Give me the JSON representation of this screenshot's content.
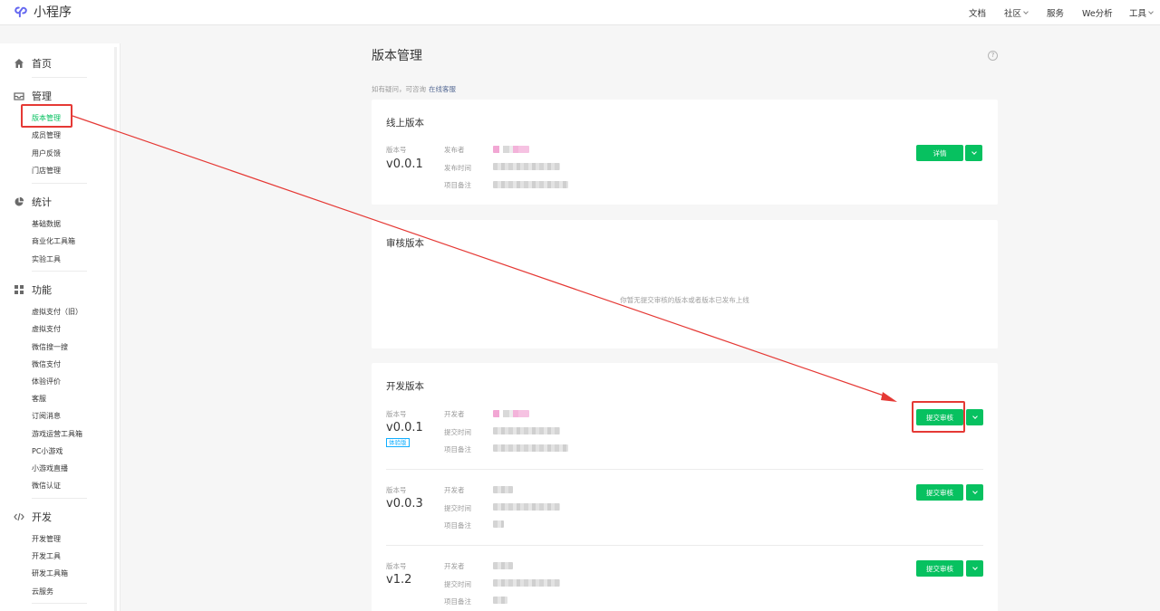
{
  "topbar": {
    "app_title": "小程序",
    "nav": [
      {
        "label": "文档",
        "dropdown": false
      },
      {
        "label": "社区",
        "dropdown": true
      },
      {
        "label": "服务",
        "dropdown": false
      },
      {
        "label": "We分析",
        "dropdown": false
      },
      {
        "label": "工具",
        "dropdown": true
      }
    ]
  },
  "sidebar": {
    "sections": [
      {
        "title": "首页",
        "icon": "home-icon",
        "items": []
      },
      {
        "title": "管理",
        "icon": "inbox-icon",
        "items": [
          "版本管理",
          "成员管理",
          "用户反馈",
          "门店管理"
        ]
      },
      {
        "title": "统计",
        "icon": "pie-chart-icon",
        "items": [
          "基础数据",
          "商业化工具箱",
          "实验工具"
        ]
      },
      {
        "title": "功能",
        "icon": "grid-icon",
        "items": [
          "虚拟支付（旧）",
          "虚拟支付",
          "微信搜一搜",
          "微信支付",
          "体验评价",
          "客服",
          "订阅消息",
          "游戏运营工具箱",
          "PC小游戏",
          "小游戏直播",
          "微信认证"
        ]
      },
      {
        "title": "开发",
        "icon": "code-icon",
        "items": [
          "开发管理",
          "开发工具",
          "研发工具箱",
          "云服务"
        ]
      }
    ],
    "active_item": "版本管理"
  },
  "main": {
    "title": "版本管理",
    "help_text": "如有疑问，可咨询",
    "help_link": "在线客服",
    "online": {
      "title": "线上版本",
      "version_label": "版本号",
      "version": "v0.0.1",
      "fields": [
        "发布者",
        "发布时间",
        "项目备注"
      ],
      "detail_button": "详情"
    },
    "review": {
      "title": "审核版本",
      "empty_text": "你暂无提交审核的版本或者版本已发布上线"
    },
    "dev": {
      "title": "开发版本",
      "version_label": "版本号",
      "fields": [
        "开发者",
        "提交时间",
        "项目备注"
      ],
      "submit_button": "提交审核",
      "versions": [
        {
          "version": "v0.0.1",
          "badge": "体验版"
        },
        {
          "version": "v0.0.3",
          "badge": ""
        },
        {
          "version": "v1.2",
          "badge": ""
        }
      ]
    }
  },
  "colors": {
    "accent": "#07c160",
    "annotation": "#e53935",
    "link": "#576b95",
    "badge": "#10aeff"
  }
}
